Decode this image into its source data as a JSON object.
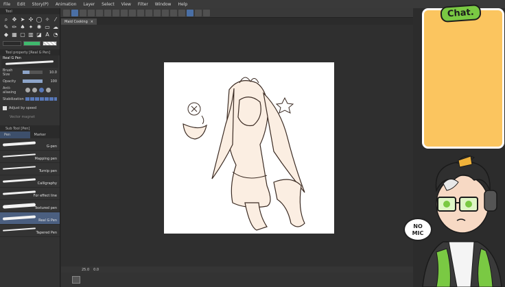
{
  "menu": [
    "File",
    "Edit",
    "Story(P)",
    "Animation",
    "Layer",
    "Select",
    "View",
    "Filter",
    "Window",
    "Help"
  ],
  "left": {
    "tool_tab": "Tool",
    "tool_property_tab": "Tool property [Real G Pen]",
    "brush_name": "Real G Pen",
    "props": [
      {
        "label": "Brush Size",
        "value": "10.0",
        "fraction": 0.35
      },
      {
        "label": "Opacity",
        "value": "100",
        "fraction": 1.0
      }
    ],
    "anti_aliasing": "Anti-aliasing",
    "stabilization": "Stabilization",
    "adjust_by_speed": "Adjust by speed",
    "vector_magnet": "Vector magnet",
    "sub_tool_tab": "Sub Tool [Pen]",
    "subtabs": [
      "Pen",
      "Marker"
    ],
    "brushes": [
      "G-pen",
      "Mapping pen",
      "Turnip pen",
      "Calligraphy",
      "For effect line",
      "Textured pen",
      "Real G Pen",
      "Tapered Pen"
    ],
    "selected_brush": "Real G Pen",
    "colors": {
      "main": "#2a2a2a",
      "sub": "#3fba6e"
    }
  },
  "doc_tab": "Maid Cooking",
  "status": {
    "zoom": "25.0",
    "angle": "0.0"
  },
  "overlay": {
    "chat_label": "Chat.",
    "no_mic_line1": "NO",
    "no_mic_line2": "MIC",
    "chat_color": "#fbc55f"
  }
}
